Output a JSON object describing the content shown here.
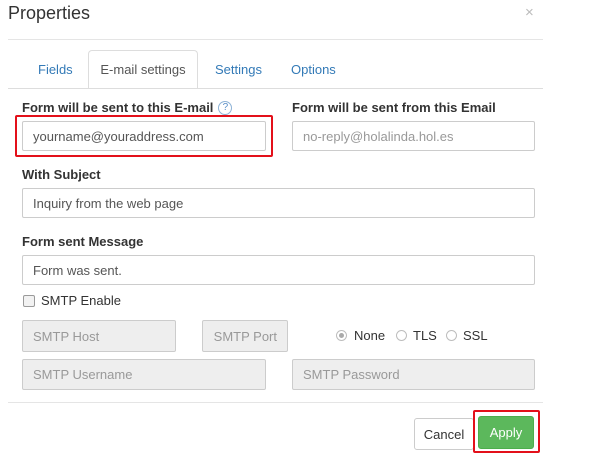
{
  "dialog": {
    "title": "Properties",
    "close_glyph": "×"
  },
  "tabs": [
    {
      "label": "Fields",
      "active": false
    },
    {
      "label": "E-mail settings",
      "active": true
    },
    {
      "label": "Settings",
      "active": false
    },
    {
      "label": "Options",
      "active": false
    }
  ],
  "email": {
    "to_label": "Form will be sent to this E-mail",
    "help_glyph": "?",
    "to_value": "yourname@youraddress.com",
    "from_label": "Form will be sent from this Email",
    "from_placeholder": "no-reply@holalinda.hol.es",
    "subject_label": "With Subject",
    "subject_value": "Inquiry from the web page",
    "message_label": "Form sent Message",
    "message_value": "Form was sent."
  },
  "smtp": {
    "enable_label": "SMTP Enable",
    "enabled": false,
    "host_placeholder": "SMTP Host",
    "port_placeholder": "SMTP Port",
    "username_placeholder": "SMTP Username",
    "password_placeholder": "SMTP Password",
    "security_options": [
      {
        "label": "None",
        "checked": true
      },
      {
        "label": "TLS",
        "checked": false
      },
      {
        "label": "SSL",
        "checked": false
      }
    ]
  },
  "footer": {
    "cancel_label": "Cancel",
    "apply_label": "Apply"
  },
  "colors": {
    "highlight": "#e3101a",
    "apply_green": "#5cb85c",
    "link_blue": "#337ab7"
  },
  "icons": {
    "close": "close-icon",
    "help": "help-icon"
  }
}
